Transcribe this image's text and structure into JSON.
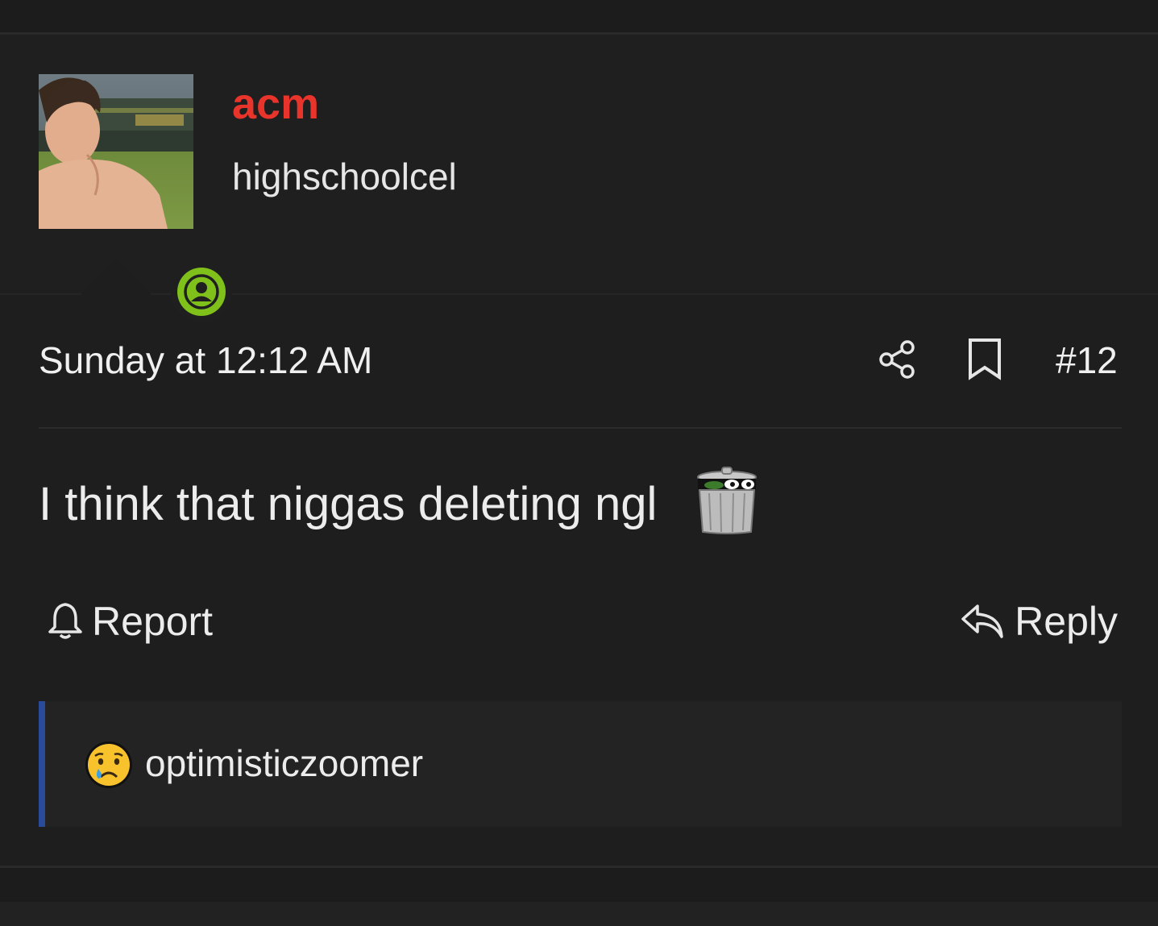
{
  "post": {
    "author": {
      "username": "acm",
      "title": "highschoolcel",
      "online_status": "online"
    },
    "timestamp": "Sunday at 12:12 AM",
    "post_number": "#12",
    "message": "I think that niggas deleting ngl",
    "message_emoji": "trash-can-pepe-emoji"
  },
  "actions": {
    "report_label": "Report",
    "reply_label": "Reply"
  },
  "reactions": {
    "emoji": "crying-sad-face-emoji",
    "users": "optimisticzoomer"
  },
  "colors": {
    "username": "#e8342a",
    "online_badge": "#7fc11a",
    "reactions_accent": "#2a4a9a",
    "background": "#1e1e1f"
  }
}
